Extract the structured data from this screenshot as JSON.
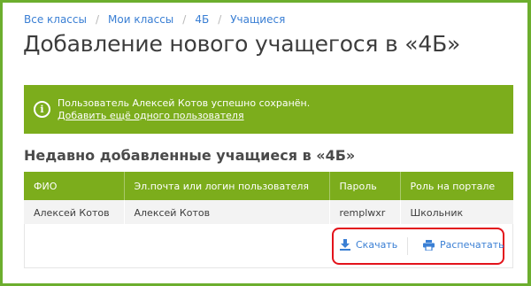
{
  "breadcrumb": {
    "items": [
      "Все классы",
      "Мои классы",
      "4Б",
      "Учащиеся"
    ],
    "separator": "/"
  },
  "page": {
    "title": "Добавление нового учащегося в «4Б»"
  },
  "alert": {
    "message": "Пользователь Алексей Котов успешно сохранён.",
    "link": "Добавить ещё одного пользователя",
    "icon": "info-icon"
  },
  "section": {
    "title": "Недавно добавленные учащиеся в «4Б»"
  },
  "table": {
    "columns": [
      "ФИО",
      "Эл.почта или логин пользователя",
      "Пароль",
      "Роль на портале"
    ],
    "rows": [
      [
        "Алексей Котов",
        "Алексей Котов",
        "remplwxr",
        "Школьник"
      ]
    ]
  },
  "actions": {
    "download_label": "Скачать",
    "print_label": "Распечатать"
  },
  "colors": {
    "accent_green": "#7cad1c",
    "link_blue": "#3a7fd4",
    "highlight_red": "#e3131b"
  }
}
